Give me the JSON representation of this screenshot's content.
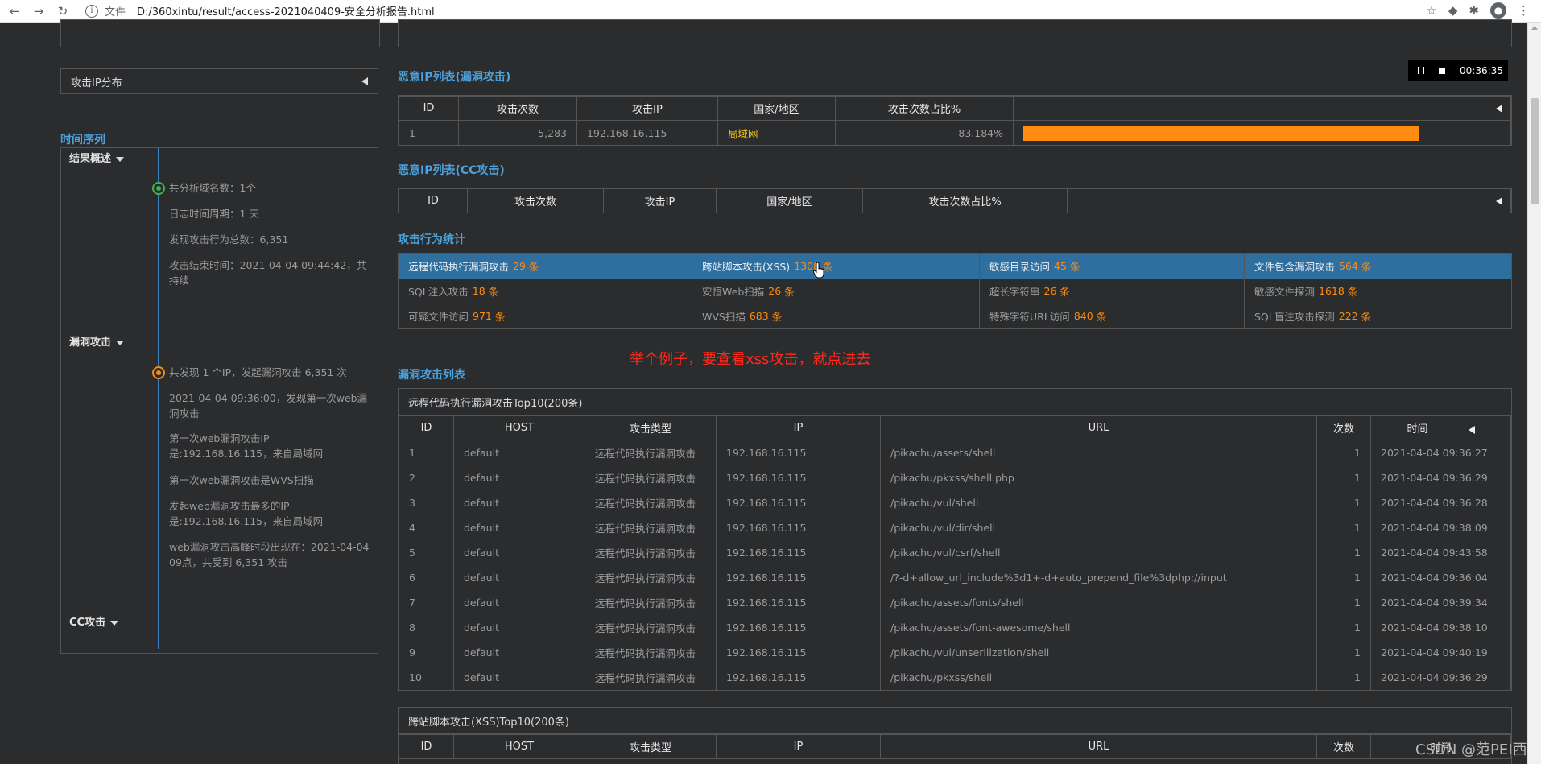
{
  "browser": {
    "scheme": "文件",
    "url": "D:/360xintu/result/access-2021040409-安全分析报告.html"
  },
  "sidebar": {
    "ip_dist_label": "攻击IP分布",
    "timeline_title": "时间序列",
    "groups": [
      {
        "label": "结果概述"
      },
      {
        "label": "漏洞攻击"
      },
      {
        "label": "CC攻击"
      }
    ],
    "summary_items": [
      "共分析域名数：1个",
      "日志时间周期：1 天",
      "发现攻击行为总数：6,351",
      "攻击结束时间：2021-04-04 09:44:42，共持续"
    ],
    "vuln_items": [
      "共发现 1 个IP，发起漏洞攻击 6,351 次",
      "2021-04-04 09:36:00，发现第一次web漏洞攻击",
      "第一次web漏洞攻击IP是:192.168.16.115，来自局域网",
      "第一次web漏洞攻击是WVS扫描",
      "发起web漏洞攻击最多的IP是:192.168.16.115，来自局域网",
      "web漏洞攻击高峰时段出现在：2021-04-04 09点，共受到 6,351 攻击"
    ]
  },
  "media": {
    "time": "00:36:35"
  },
  "malicious_vuln": {
    "title": "恶意IP列表(漏洞攻击)",
    "headers": [
      "ID",
      "攻击次数",
      "攻击IP",
      "国家/地区",
      "攻击次数占比%"
    ],
    "rows": [
      {
        "id": "1",
        "count": "5,283",
        "ip": "192.168.16.115",
        "region": "局域网",
        "pct": "83.184%",
        "fraction": 0.83
      }
    ]
  },
  "malicious_cc": {
    "title": "恶意IP列表(CC攻击)",
    "headers": [
      "ID",
      "攻击次数",
      "攻击IP",
      "国家/地区",
      "攻击次数占比%"
    ]
  },
  "stats": {
    "title": "攻击行为统计",
    "unit": "条",
    "cells": [
      {
        "label": "远程代码执行漏洞攻击",
        "count": "29"
      },
      {
        "label": "跨站脚本攻击(XSS)",
        "count": "1308"
      },
      {
        "label": "敏感目录访问",
        "count": "45"
      },
      {
        "label": "文件包含漏洞攻击",
        "count": "564"
      },
      {
        "label": "SQL注入攻击",
        "count": "18"
      },
      {
        "label": "安恒Web扫描",
        "count": "26"
      },
      {
        "label": "超长字符串",
        "count": "26"
      },
      {
        "label": "敏感文件探测",
        "count": "1618"
      },
      {
        "label": "可疑文件访问",
        "count": "971"
      },
      {
        "label": "WVS扫描",
        "count": "683"
      },
      {
        "label": "特殊字符URL访问",
        "count": "840"
      },
      {
        "label": "SQL盲注攻击探测",
        "count": "222"
      }
    ]
  },
  "annotation": "举个例子，要查看xss攻击，就点进去",
  "vuln_list": {
    "title": "漏洞攻击列表",
    "rce_title": "远程代码执行漏洞攻击Top10(200条)",
    "xss_title": "跨站脚本攻击(XSS)Top10(200条)",
    "headers": [
      "ID",
      "HOST",
      "攻击类型",
      "IP",
      "URL",
      "次数",
      "时间"
    ],
    "rows": [
      {
        "id": "1",
        "host": "default",
        "type": "远程代码执行漏洞攻击",
        "ip": "192.168.16.115",
        "url": "/pikachu/assets/shell",
        "n": "1",
        "time": "2021-04-04 09:36:27"
      },
      {
        "id": "2",
        "host": "default",
        "type": "远程代码执行漏洞攻击",
        "ip": "192.168.16.115",
        "url": "/pikachu/pkxss/shell.php",
        "n": "1",
        "time": "2021-04-04 09:36:29"
      },
      {
        "id": "3",
        "host": "default",
        "type": "远程代码执行漏洞攻击",
        "ip": "192.168.16.115",
        "url": "/pikachu/vul/shell",
        "n": "1",
        "time": "2021-04-04 09:36:28"
      },
      {
        "id": "4",
        "host": "default",
        "type": "远程代码执行漏洞攻击",
        "ip": "192.168.16.115",
        "url": "/pikachu/vul/dir/shell",
        "n": "1",
        "time": "2021-04-04 09:38:09"
      },
      {
        "id": "5",
        "host": "default",
        "type": "远程代码执行漏洞攻击",
        "ip": "192.168.16.115",
        "url": "/pikachu/vul/csrf/shell",
        "n": "1",
        "time": "2021-04-04 09:43:58"
      },
      {
        "id": "6",
        "host": "default",
        "type": "远程代码执行漏洞攻击",
        "ip": "192.168.16.115",
        "url": "/?-d+allow_url_include%3d1+-d+auto_prepend_file%3dphp://input",
        "n": "1",
        "time": "2021-04-04 09:36:04"
      },
      {
        "id": "7",
        "host": "default",
        "type": "远程代码执行漏洞攻击",
        "ip": "192.168.16.115",
        "url": "/pikachu/assets/fonts/shell",
        "n": "1",
        "time": "2021-04-04 09:39:34"
      },
      {
        "id": "8",
        "host": "default",
        "type": "远程代码执行漏洞攻击",
        "ip": "192.168.16.115",
        "url": "/pikachu/assets/font-awesome/shell",
        "n": "1",
        "time": "2021-04-04 09:38:10"
      },
      {
        "id": "9",
        "host": "default",
        "type": "远程代码执行漏洞攻击",
        "ip": "192.168.16.115",
        "url": "/pikachu/vul/unserilization/shell",
        "n": "1",
        "time": "2021-04-04 09:40:19"
      },
      {
        "id": "10",
        "host": "default",
        "type": "远程代码执行漏洞攻击",
        "ip": "192.168.16.115",
        "url": "/pikachu/pkxss/shell",
        "n": "1",
        "time": "2021-04-04 09:36:29"
      }
    ]
  },
  "watermark": "CSDN @范PEI西"
}
